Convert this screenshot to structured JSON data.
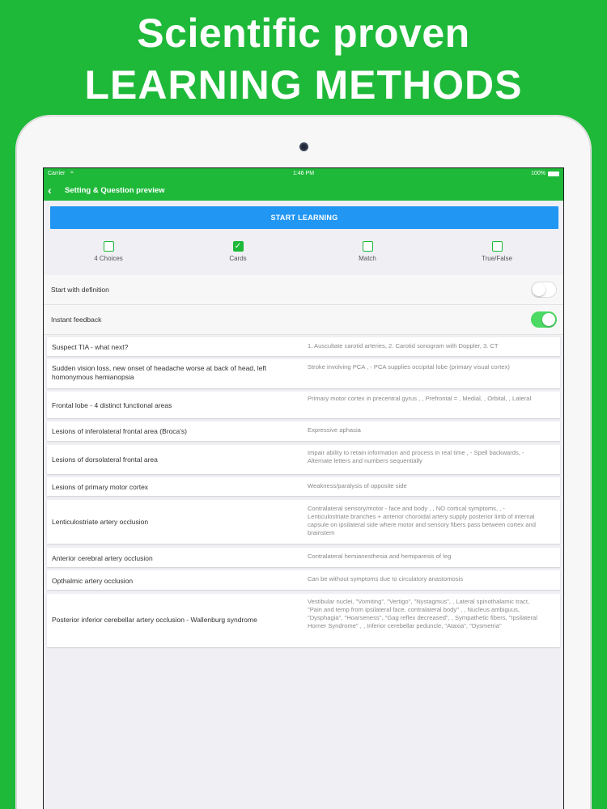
{
  "headline": {
    "line1": "Scientific proven",
    "line2": "LEARNING METHODS"
  },
  "status_bar": {
    "carrier": "Carrier",
    "time": "1:46 PM",
    "battery": "100%"
  },
  "nav": {
    "back_icon": "chevron-left-icon",
    "title": "Setting & Question preview"
  },
  "start_button": "START LEARNING",
  "modes": [
    {
      "label": "4 Choices",
      "checked": false
    },
    {
      "label": "Cards",
      "checked": true
    },
    {
      "label": "Match",
      "checked": false
    },
    {
      "label": "True/False",
      "checked": false
    }
  ],
  "settings": [
    {
      "label": "Start with definition",
      "on": false
    },
    {
      "label": "Instant feedback",
      "on": true
    }
  ],
  "cards": [
    {
      "term": "Suspect TIA - what next?",
      "definition": "1. Auscultate carotid arteries, 2. Carotid sonogram with Doppler, 3. CT"
    },
    {
      "term": "Sudden vision loss, new onset of headache worse at back of head, left homonymous hemianopsia",
      "definition": "Stroke involving PCA , - PCA supplies occipital lobe (primary visual cortex)"
    },
    {
      "term": "Frontal lobe - 4 distinct functional areas",
      "definition": "Primary motor cortex in precentral gyrus , , Prefrontal = , Medial, , Orbital, , Lateral"
    },
    {
      "term": "Lesions of inferolateral frontal area (Broca's)",
      "definition": "Expressive aphasia"
    },
    {
      "term": "Lesions of dorsolateral frontal area",
      "definition": "Impair ability to retain information and process in real time , - Spell backwards, - Alternate letters and numbers sequentially"
    },
    {
      "term": "Lesions of primary motor cortex",
      "definition": "Weakness/paralysis of opposite side"
    },
    {
      "term": "Lenticulostriate artery occlusion",
      "definition": "Contralateral sensory/motor - face and body , , NO cortical symptoms, , - Lenticulostriate branches + anterior choroidal artery supply posterior limb of internal capsule on ipsilateral side where motor and sensory fibers pass between cortex and brainstem"
    },
    {
      "term": "Anterior cerebral artery occlusion",
      "definition": "Contralateral hemianesthesia and hemiparesis of leg"
    },
    {
      "term": "Opthalmic artery occlusion",
      "definition": "Can be without symptoms due to circulatory anastomosis"
    },
    {
      "term": "Posterior inferior cerebellar artery occlusion - Wallenburg syndrome",
      "definition": "Vestibular nuclei, \"Vomiting\", \"Vertigo\", \"Nystagmus\", , Lateral spinothalamic tract, \"Pain and temp from ipsilateral face, contralateral body\" , , Nucleus ambiguus, \"Dysphagia\", \"Hoarseness\", \"Gag reflex decreased\", , Sympathetic fibers, \"Ipsilateral Horner Syndrome\" , , Inferior cerebellar peduncle, \"Ataxia\", \"Dysmetria\""
    }
  ],
  "colors": {
    "brand_green": "#1fb93a",
    "button_blue": "#2196f3",
    "toggle_on": "#4cd964"
  }
}
